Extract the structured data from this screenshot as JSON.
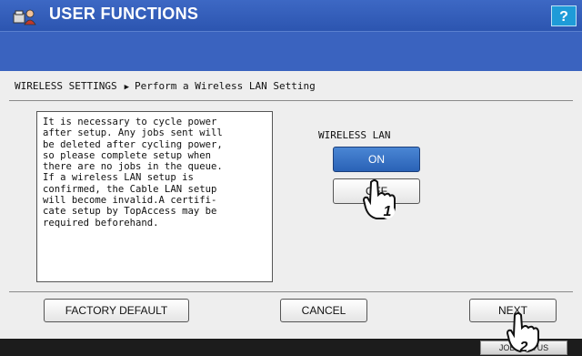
{
  "header": {
    "title": "USER FUNCTIONS",
    "help_label": "?",
    "icon": "user-functions-icon"
  },
  "breadcrumb": {
    "section": "WIRELESS SETTINGS",
    "separator_icon": "right-triangle-icon",
    "page": "Perform a Wireless LAN Setting"
  },
  "message": {
    "lines": [
      "It is necessary to cycle power",
      "after setup. Any jobs sent will",
      "be deleted after cycling power,",
      "so please complete setup when",
      "there are no jobs in the queue.",
      "If a wireless LAN setup is",
      "confirmed, the Cable LAN setup",
      "will become invalid.A certifi-",
      "cate setup by TopAccess may be",
      "required beforehand."
    ]
  },
  "wireless_lan": {
    "label": "WIRELESS LAN",
    "on_label": "ON",
    "off_label": "OFF",
    "selected": "ON"
  },
  "footer": {
    "factory_default_label": "FACTORY DEFAULT",
    "cancel_label": "CANCEL",
    "next_label": "NEXT"
  },
  "statusbar": {
    "job_status_label": "JOB STATUS"
  },
  "callouts": {
    "step1": "1",
    "step2": "2"
  },
  "colors": {
    "title_bar": "#2c55b0",
    "selected_button": "#2a62b6",
    "help_button": "#1e9bd8"
  }
}
